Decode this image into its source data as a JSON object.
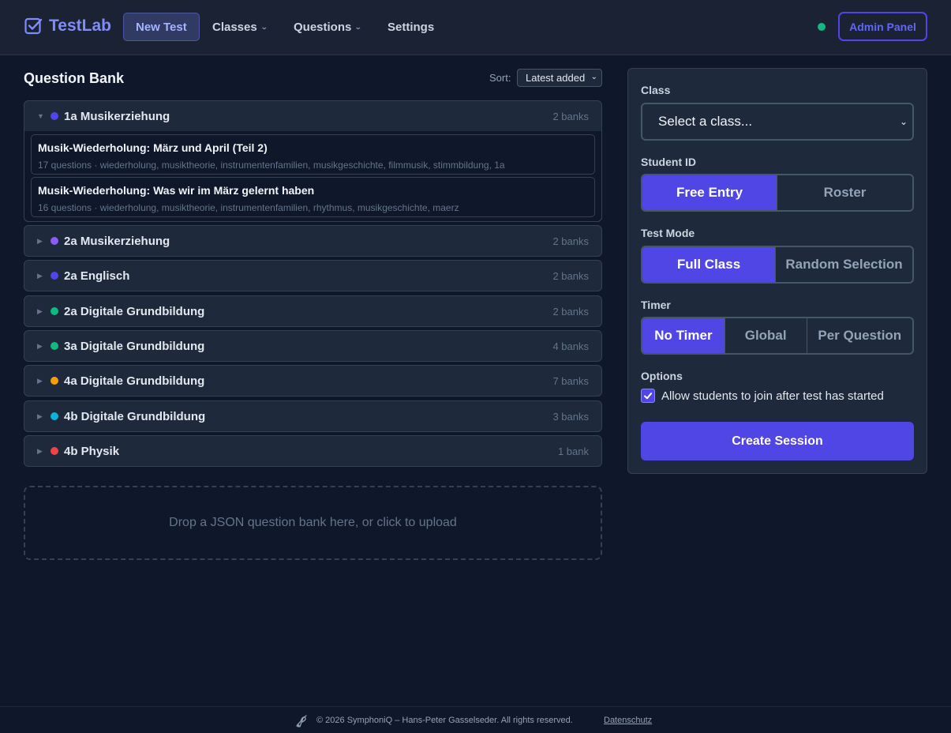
{
  "header": {
    "brand": "TestLab",
    "nav": {
      "new_test": "New Test",
      "classes": "Classes",
      "questions": "Questions",
      "settings": "Settings"
    },
    "status_color": "#10b981",
    "admin_button": "Admin Panel",
    "accent": "#4f46e5"
  },
  "question_bank": {
    "title": "Question Bank",
    "sort_label": "Sort:",
    "sort_value": "Latest added",
    "classes": [
      {
        "name": "1a Musikerziehung",
        "count": "2 banks",
        "color": "#4f46e5",
        "expanded": true,
        "banks": [
          {
            "title": "Musik-Wiederholung: März und April (Teil 2)",
            "meta": "17 questions · wiederholung, musiktheorie, instrumentenfamilien, musikgeschichte, filmmusik, stimmbildung, 1a"
          },
          {
            "title": "Musik-Wiederholung: Was wir im März gelernt haben",
            "meta": "16 questions · wiederholung, musiktheorie, instrumentenfamilien, rhythmus, musikgeschichte, maerz"
          }
        ]
      },
      {
        "name": "2a Musikerziehung",
        "count": "2 banks",
        "color": "#8b5cf6"
      },
      {
        "name": "2a Englisch",
        "count": "2 banks",
        "color": "#4f46e5"
      },
      {
        "name": "2a Digitale Grundbildung",
        "count": "2 banks",
        "color": "#10b981"
      },
      {
        "name": "3a Digitale Grundbildung",
        "count": "4 banks",
        "color": "#10b981"
      },
      {
        "name": "4a Digitale Grundbildung",
        "count": "7 banks",
        "color": "#f59e0b"
      },
      {
        "name": "4b Digitale Grundbildung",
        "count": "3 banks",
        "color": "#06b6d4"
      },
      {
        "name": "4b Physik",
        "count": "1 bank",
        "color": "#ef4444"
      }
    ],
    "dropzone": "Drop a JSON question bank here, or click to upload"
  },
  "panel": {
    "class_label": "Class",
    "class_placeholder": "Select a class...",
    "student_id_label": "Student ID",
    "student_id_options": [
      "Free Entry",
      "Roster"
    ],
    "student_id_selected": "Free Entry",
    "test_mode_label": "Test Mode",
    "test_mode_options": [
      "Full Class",
      "Random Selection"
    ],
    "test_mode_selected": "Full Class",
    "timer_label": "Timer",
    "timer_options": [
      "No Timer",
      "Global",
      "Per Question"
    ],
    "timer_selected": "No Timer",
    "options_label": "Options",
    "allow_late_join_label": "Allow students to join after test has started",
    "allow_late_join_checked": true,
    "create_button": "Create Session"
  },
  "footer": {
    "copyright": "© 2026 SymphoniQ – Hans-Peter Gasselseder. All rights reserved.",
    "privacy_link": "Datenschutz"
  }
}
